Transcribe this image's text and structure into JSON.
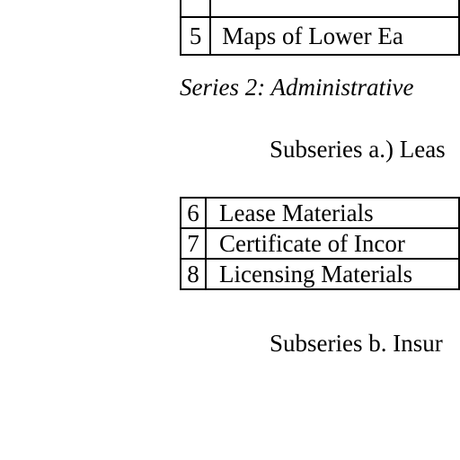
{
  "top_table": {
    "rows": [
      {
        "number": "",
        "title": ""
      },
      {
        "number": "5",
        "title": "Maps of Lower Ea"
      }
    ]
  },
  "series": {
    "heading": "Series 2: Administrative"
  },
  "subseries_a": {
    "heading": "Subseries a.) Leas"
  },
  "admin_table": {
    "rows": [
      {
        "number": "6",
        "title": "Lease Materials"
      },
      {
        "number": "7",
        "title": "Certificate of Incor"
      },
      {
        "number": "8",
        "title": "Licensing Materials"
      }
    ]
  },
  "subseries_b": {
    "heading": "Subseries b. Insur"
  }
}
